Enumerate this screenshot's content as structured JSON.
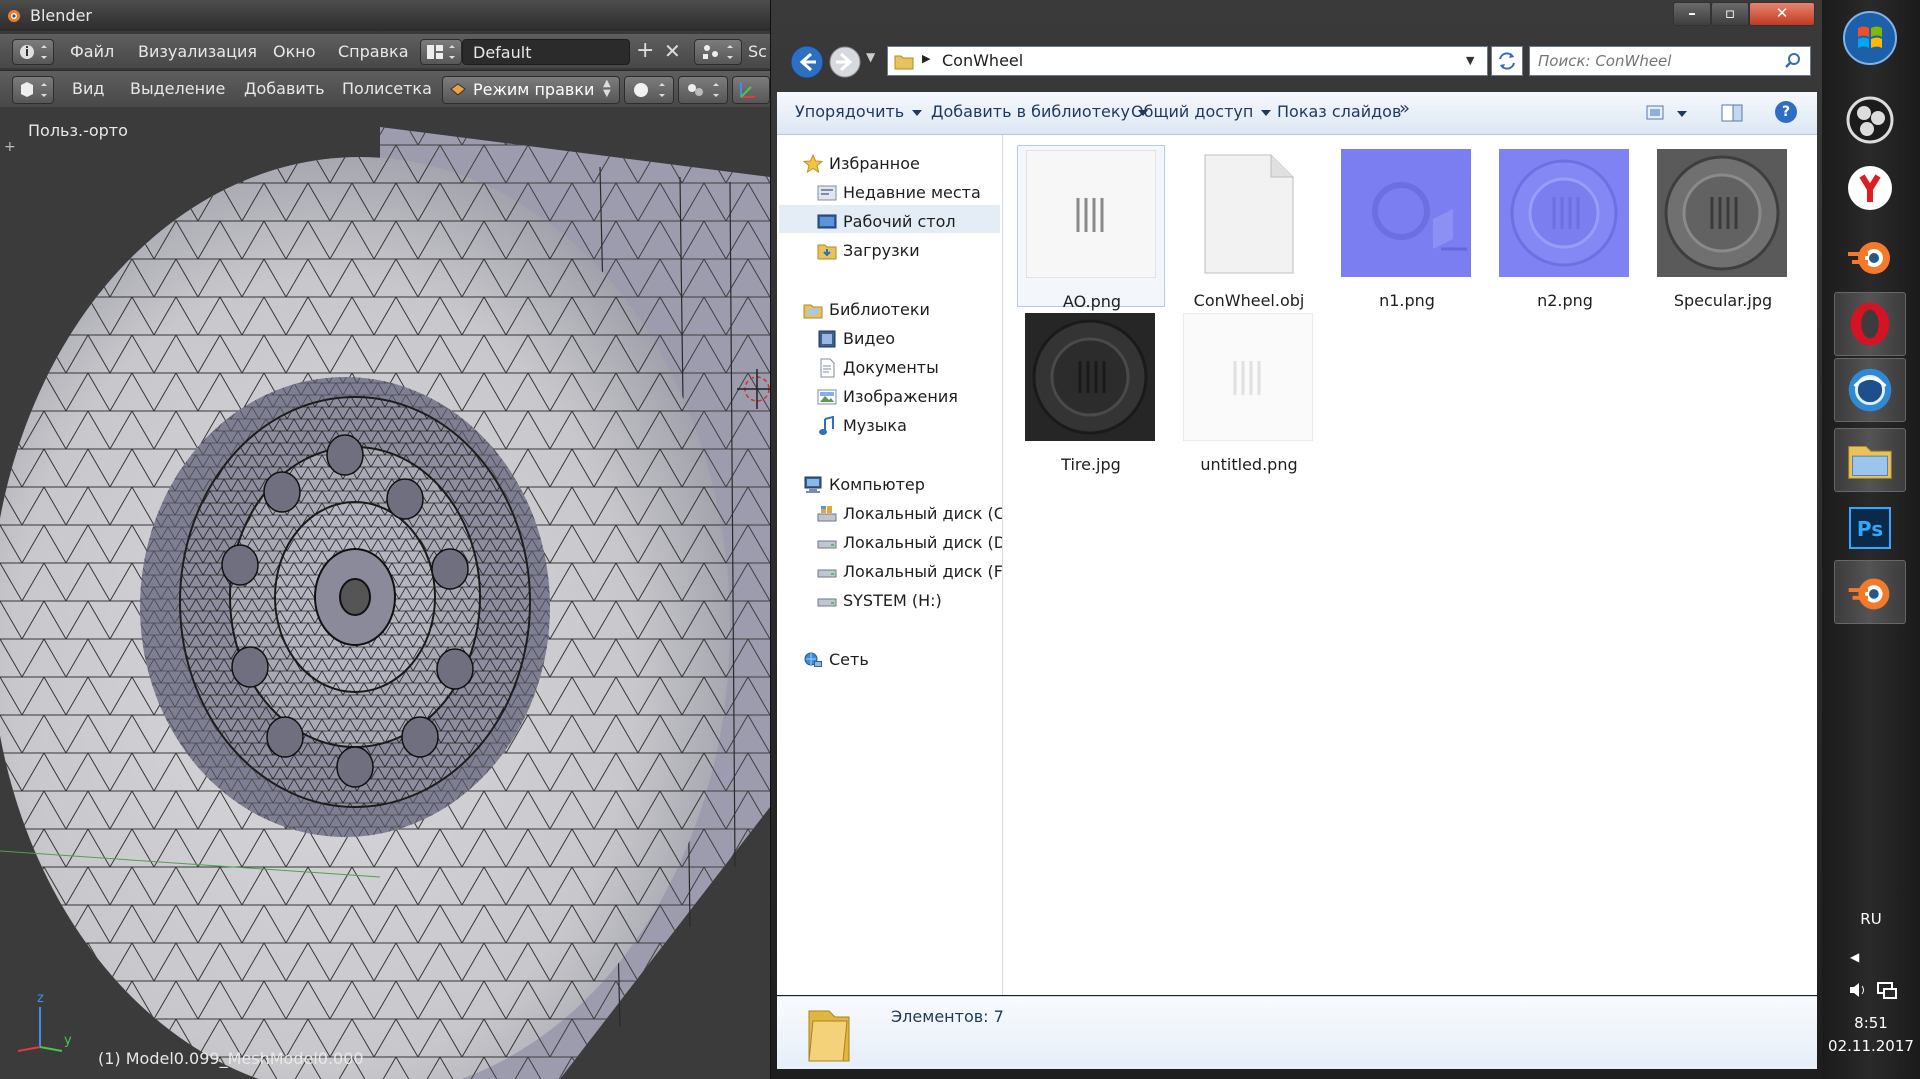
{
  "blender": {
    "title": "Blender",
    "menu": [
      "Файл",
      "Визуализация",
      "Окно",
      "Справка"
    ],
    "layout_name": "Default",
    "scene_prefix": "Sc",
    "toolbar": [
      "Вид",
      "Выделение",
      "Добавить",
      "Полисетка"
    ],
    "mode": "Режим правки",
    "view_label": "Польз.-орто",
    "status": "(1) Model0.099_MeshModel0.000",
    "axis_z": "z",
    "axis_y": "y"
  },
  "explorer": {
    "path": "ConWheel",
    "search_placeholder": "Поиск: ConWheel",
    "commands": [
      "Упорядочить",
      "Добавить в библиотеку",
      "Общий доступ",
      "Показ слайдов"
    ],
    "more": "»",
    "help": "?",
    "nav": {
      "favorites": "Избранное",
      "recent": "Недавние места",
      "desktop": "Рабочий стол",
      "downloads": "Загрузки",
      "libraries": "Библиотеки",
      "video": "Видео",
      "documents": "Документы",
      "pictures": "Изображения",
      "music": "Музыка",
      "computer": "Компьютер",
      "disk_c": "Локальный диск (C",
      "disk_d": "Локальный диск (D",
      "disk_f": "Локальный диск (F:",
      "disk_h": "SYSTEM (H:)",
      "network": "Сеть"
    },
    "files": [
      "AO.png",
      "ConWheel.obj",
      "n1.png",
      "n2.png",
      "Specular.jpg",
      "Tire.jpg",
      "untitled.png"
    ],
    "status": "Элементов: 7"
  },
  "taskbar": {
    "apps": [
      "windows-start",
      "obs",
      "yandex-browser",
      "blender",
      "opera",
      "browser",
      "explorer",
      "photoshop",
      "blender"
    ],
    "lang": "RU",
    "time": "8:51",
    "date": "02.11.2017"
  },
  "colors": {
    "explorer_accent": "#1e395b",
    "selection": "#cde3f7",
    "normal_map": "#7a7ef0"
  }
}
